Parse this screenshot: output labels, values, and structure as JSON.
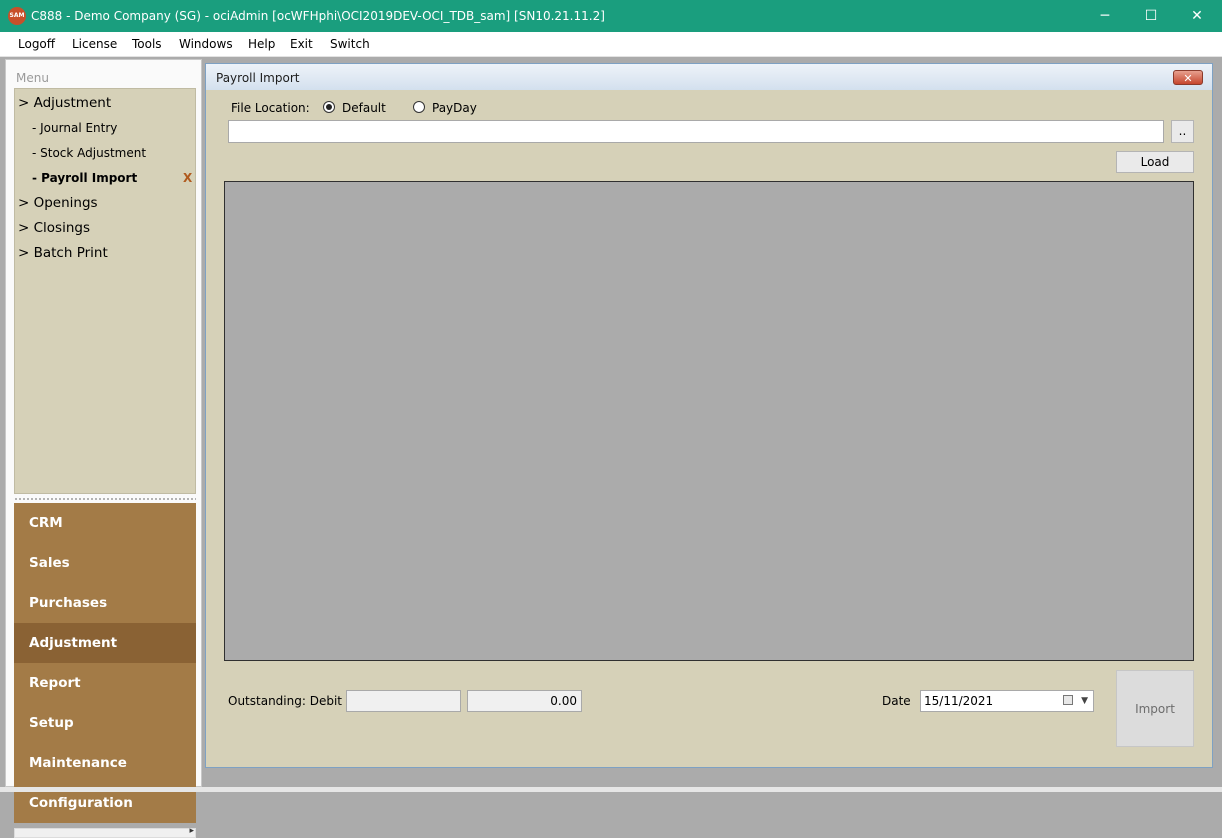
{
  "window": {
    "logo_text": "SAM",
    "title": "C888 - Demo Company (SG) - ociAdmin [ocWFHphi\\OCI2019DEV-OCI_TDB_sam] [SN10.21.11.2]",
    "minimize_glyph": "─",
    "maximize_glyph": "☐",
    "close_glyph": "✕"
  },
  "menubar": [
    "Logoff",
    "License",
    "Tools",
    "Windows",
    "Help",
    "Exit",
    "Switch"
  ],
  "sidebar": {
    "header": "Menu",
    "tree": [
      {
        "label": "> Adjustment",
        "level": 0
      },
      {
        "label": "- Journal Entry",
        "level": 1
      },
      {
        "label": "- Stock Adjustment",
        "level": 1
      },
      {
        "label": "- Payroll Import",
        "level": 1,
        "active": true
      },
      {
        "label": "> Openings",
        "level": 0
      },
      {
        "label": "> Closings",
        "level": 0
      },
      {
        "label": "> Batch Print",
        "level": 0
      }
    ],
    "close_marker": "X",
    "modules": [
      "CRM",
      "Sales",
      "Purchases",
      "Adjustment",
      "Report",
      "Setup",
      "Maintenance",
      "Configuration"
    ],
    "active_module": "Adjustment",
    "scroll_arrow": "▸"
  },
  "payroll_import": {
    "title": "Payroll Import",
    "close_glyph": "✕",
    "file_location_label": "File Location:",
    "radio_default": "Default",
    "radio_payday": "PayDay",
    "selected_location": "Default",
    "file_path": "",
    "browse_label": "..",
    "load_label": "Load",
    "outstanding_label": "Outstanding: Debit",
    "outstanding_debit": "",
    "outstanding_amount": "0.00",
    "date_label": "Date",
    "date_value": "15/11/2021",
    "date_dropdown_glyph": "▼",
    "import_label": "Import"
  },
  "colors": {
    "titlebar": "#1a9e7e",
    "panel_beige": "#d6d1b8",
    "module_brown": "#a37b47",
    "module_active": "#8a6234",
    "grid_gray": "#ababab"
  }
}
